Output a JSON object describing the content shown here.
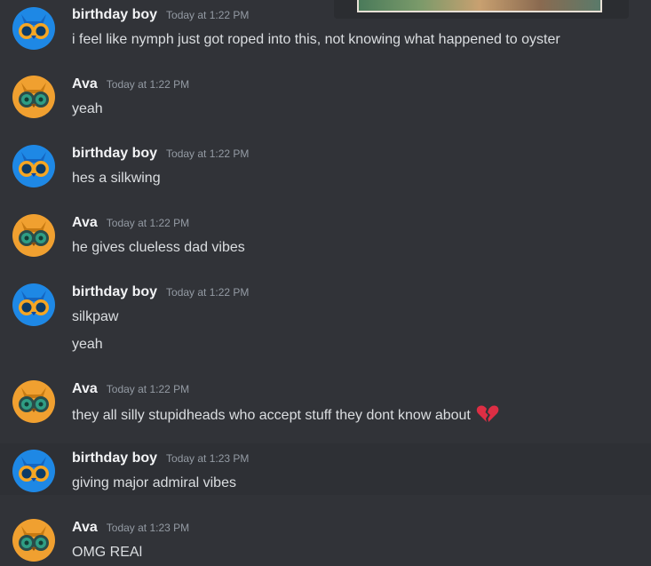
{
  "attachment": {
    "icon": "image-attachment-preview"
  },
  "colors": {
    "background": "#313338",
    "hover_row": "#2e3035",
    "username": "#f2f3f5",
    "timestamp": "#949ba4",
    "message_text": "#dbdee1",
    "avatar_blue": "#1e88e5",
    "avatar_orange": "#f0a030",
    "broken_heart": "#dd2e44"
  },
  "messages": [
    {
      "author": "birthday boy",
      "timestamp": "Today at 1:22 PM",
      "avatar_icon": "blue-owl-avatar",
      "lines": [
        "i feel like nymph just got roped into this, not knowing what happened to oyster"
      ]
    },
    {
      "author": "Ava",
      "timestamp": "Today at 1:22 PM",
      "avatar_icon": "orange-owl-avatar",
      "lines": [
        "yeah"
      ]
    },
    {
      "author": "birthday boy",
      "timestamp": "Today at 1:22 PM",
      "avatar_icon": "blue-owl-avatar",
      "lines": [
        "hes a silkwing"
      ]
    },
    {
      "author": "Ava",
      "timestamp": "Today at 1:22 PM",
      "avatar_icon": "orange-owl-avatar",
      "lines": [
        "he gives clueless dad vibes"
      ]
    },
    {
      "author": "birthday boy",
      "timestamp": "Today at 1:22 PM",
      "avatar_icon": "blue-owl-avatar",
      "lines": [
        "silkpaw",
        "yeah"
      ]
    },
    {
      "author": "Ava",
      "timestamp": "Today at 1:22 PM",
      "avatar_icon": "orange-owl-avatar",
      "lines": [
        "they all silly stupidheads who accept stuff they dont know about"
      ],
      "emoji": "broken-heart-icon"
    },
    {
      "author": "birthday boy",
      "timestamp": "Today at 1:23 PM",
      "avatar_icon": "blue-owl-avatar",
      "lines": [
        "giving major admiral vibes"
      ]
    },
    {
      "author": "Ava",
      "timestamp": "Today at 1:23 PM",
      "avatar_icon": "orange-owl-avatar",
      "lines": [
        "OMG REAl"
      ]
    }
  ]
}
